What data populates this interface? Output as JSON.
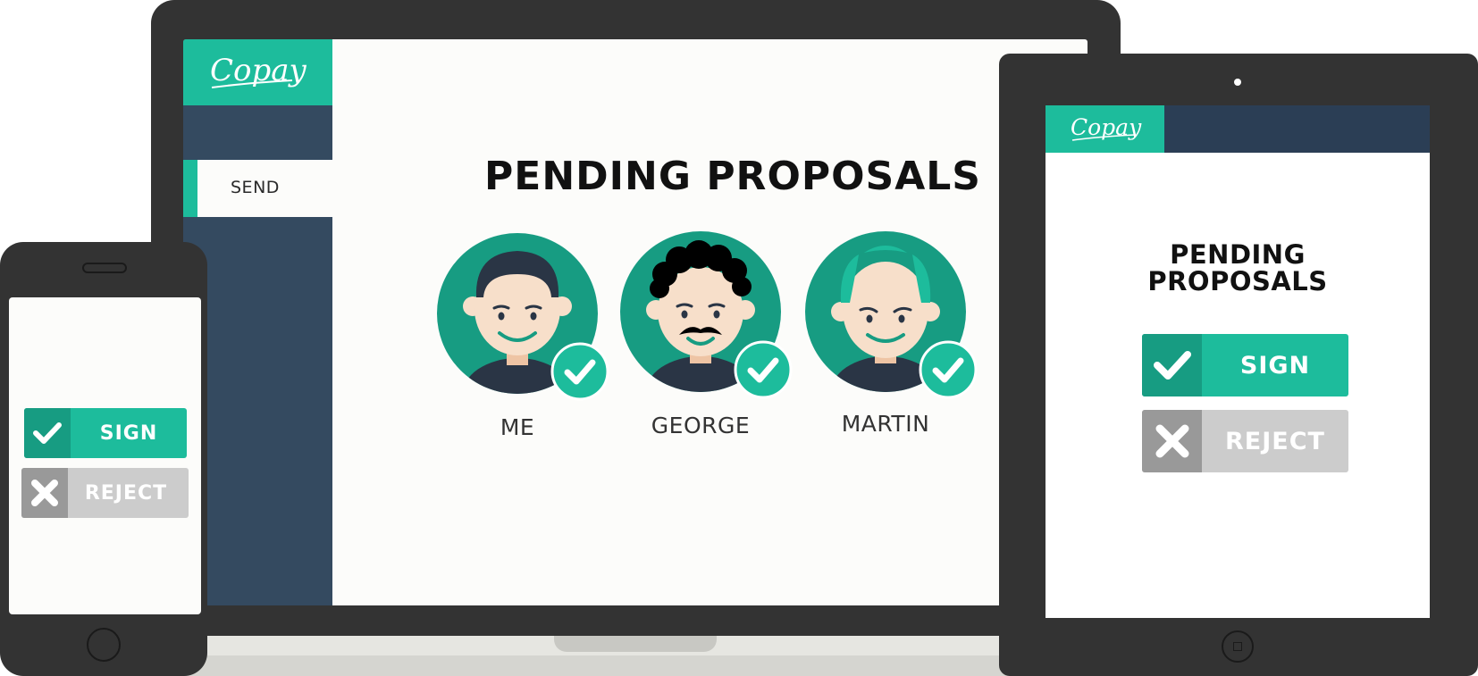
{
  "brand": {
    "name": "Copay",
    "accent": "#1dbc9c",
    "sidebar_color": "#344a60"
  },
  "laptop": {
    "sidebar": {
      "items": [
        {
          "label": "SEND",
          "active": true
        }
      ]
    },
    "main": {
      "title": "PENDING PROPOSALS",
      "cosigners": [
        {
          "name": "ME",
          "status": "signed",
          "avatar": "avatar-short-hair"
        },
        {
          "name": "GEORGE",
          "status": "signed",
          "avatar": "avatar-curly-hair-mustache"
        },
        {
          "name": "MARTIN",
          "status": "signed",
          "avatar": "avatar-balding"
        }
      ]
    }
  },
  "phone": {
    "sign_label": "SIGN",
    "reject_label": "REJECT"
  },
  "tablet": {
    "title_line1": "PENDING",
    "title_line2": "PROPOSALS",
    "sign_label": "SIGN",
    "reject_label": "REJECT"
  },
  "icons": {
    "sign": "check-icon",
    "reject": "x-icon",
    "approved_badge": "check-badge-icon"
  }
}
